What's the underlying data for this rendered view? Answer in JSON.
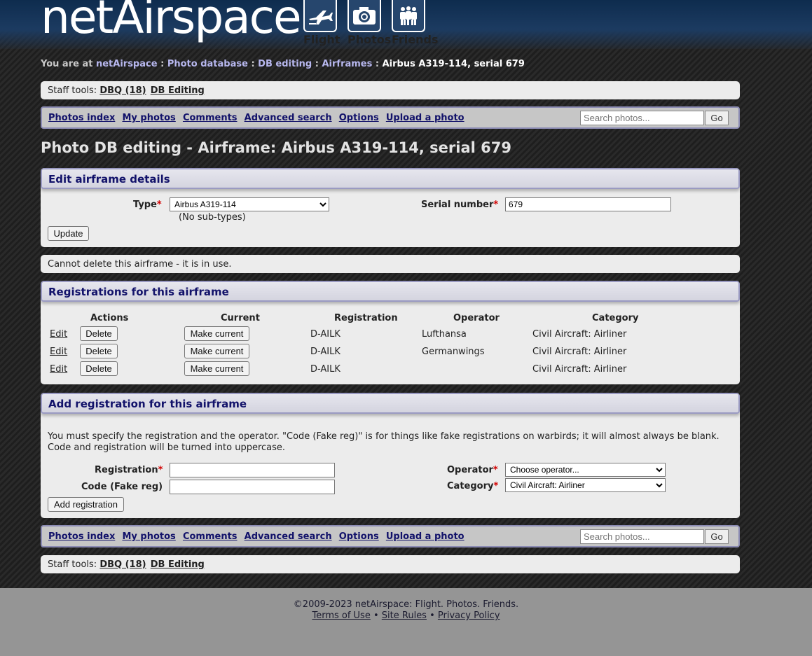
{
  "logo": {
    "text": "netAirspace",
    "icons": [
      {
        "icon": "plane-icon",
        "label": "Flight"
      },
      {
        "icon": "camera-icon",
        "label": "Photos"
      },
      {
        "icon": "people-icon",
        "label": "Friends"
      }
    ]
  },
  "breadcrumb": {
    "prefix": "You are at",
    "items": [
      "netAirspace",
      "Photo database",
      "DB editing",
      "Airframes"
    ],
    "sep": ":",
    "current": "Airbus A319-114, serial 679"
  },
  "staff_tools": {
    "label": "Staff tools:",
    "dbq": "DBQ (18)",
    "db_editing": "DB Editing"
  },
  "nav": {
    "links": [
      "Photos index",
      "My photos",
      "Comments",
      "Advanced search",
      "Options",
      "Upload a photo"
    ],
    "search_placeholder": "Search photos...",
    "go": "Go"
  },
  "page_title": "Photo DB editing - Airframe: Airbus A319-114, serial 679",
  "edit_panel": {
    "title": "Edit airframe details",
    "type_label": "Type",
    "type_value": "Airbus A319-114",
    "subtypes": "(No sub-types)",
    "serial_label": "Serial number",
    "serial_value": "679",
    "update": "Update",
    "required_mark": "*"
  },
  "delete_notice": "Cannot delete this airframe - it is in use.",
  "registrations": {
    "title": "Registrations for this airframe",
    "headers": [
      "Actions",
      "Current",
      "Registration",
      "Operator",
      "Category"
    ],
    "edit": "Edit",
    "delete": "Delete",
    "make_current": "Make current",
    "rows": [
      {
        "registration": "D-AILK",
        "operator": "Lufthansa",
        "category": "Civil Aircraft: Airliner"
      },
      {
        "registration": "D-AILK",
        "operator": "Germanwings",
        "category": "Civil Aircraft: Airliner"
      },
      {
        "registration": "D-AILK",
        "operator": "",
        "category": "Civil Aircraft: Airliner"
      }
    ]
  },
  "add_panel": {
    "title": "Add registration for this airframe",
    "help_line1": "You must specify the registration and the operator. \"Code (Fake reg)\" is for things like fake registrations on warbirds; it will almost always be blank.",
    "help_line2": "Code and registration will be turned into uppercase.",
    "registration_label": "Registration",
    "code_label": "Code (Fake reg)",
    "operator_label": "Operator",
    "operator_value": "Choose operator...",
    "category_label": "Category",
    "category_value": "Civil Aircraft: Airliner",
    "submit": "Add registration"
  },
  "footer": {
    "copyright": "©2009-2023 netAirspace: Flight. Photos. Friends.",
    "links": [
      "Terms of Use",
      "Site Rules",
      "Privacy Policy"
    ],
    "sep": "•"
  }
}
